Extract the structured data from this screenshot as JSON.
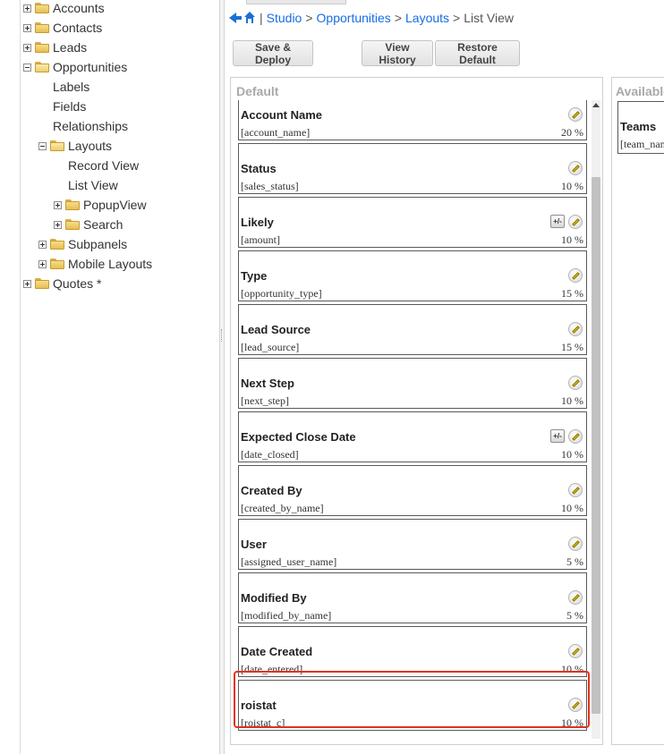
{
  "tree": {
    "items": [
      {
        "label": "Accounts"
      },
      {
        "label": "Contacts"
      },
      {
        "label": "Leads"
      },
      {
        "label": "Opportunities"
      },
      {
        "label": "Labels"
      },
      {
        "label": "Fields"
      },
      {
        "label": "Relationships"
      },
      {
        "label": "Layouts"
      },
      {
        "label": "Record View"
      },
      {
        "label": "List View"
      },
      {
        "label": "PopupView"
      },
      {
        "label": "Search"
      },
      {
        "label": "Subpanels"
      },
      {
        "label": "Mobile Layouts"
      },
      {
        "label": "Quotes *"
      }
    ]
  },
  "breadcrumb": {
    "studio": "Studio",
    "opportunities": "Opportunities",
    "layouts": "Layouts",
    "current": "List View",
    "separator": ">"
  },
  "toolbar": {
    "save_deploy": "Save & Deploy",
    "view_history": "View History",
    "restore_default": "Restore Default"
  },
  "default_panel": {
    "title": "Default",
    "fields": [
      {
        "label": "Account Name",
        "name": "[account_name]",
        "width": "20 %"
      },
      {
        "label": "Status",
        "name": "[sales_status]",
        "width": "10 %"
      },
      {
        "label": "Likely",
        "name": "[amount]",
        "width": "10 %"
      },
      {
        "label": "Type",
        "name": "[opportunity_type]",
        "width": "15 %"
      },
      {
        "label": "Lead Source",
        "name": "[lead_source]",
        "width": "15 %"
      },
      {
        "label": "Next Step",
        "name": "[next_step]",
        "width": "10 %"
      },
      {
        "label": "Expected Close Date",
        "name": "[date_closed]",
        "width": "10 %"
      },
      {
        "label": "Created By",
        "name": "[created_by_name]",
        "width": "10 %"
      },
      {
        "label": "User",
        "name": "[assigned_user_name]",
        "width": "5 %"
      },
      {
        "label": "Modified By",
        "name": "[modified_by_name]",
        "width": "5 %"
      },
      {
        "label": "Date Created",
        "name": "[date_entered]",
        "width": "10 %"
      },
      {
        "label": "roistat",
        "name": "[roistat_c]",
        "width": "10 %"
      }
    ]
  },
  "calc_icon": "+/-",
  "available_panel": {
    "title": "Available",
    "items": [
      {
        "label": "Teams",
        "name": "[team_name]"
      }
    ]
  },
  "colors": {
    "link": "#176de5",
    "highlight": "#e0321f"
  },
  "icons": {
    "back": "back-arrow-icon",
    "home": "home-icon",
    "edit": "pencil-icon",
    "calculated": "calculator-icon",
    "folder": "folder-icon"
  }
}
